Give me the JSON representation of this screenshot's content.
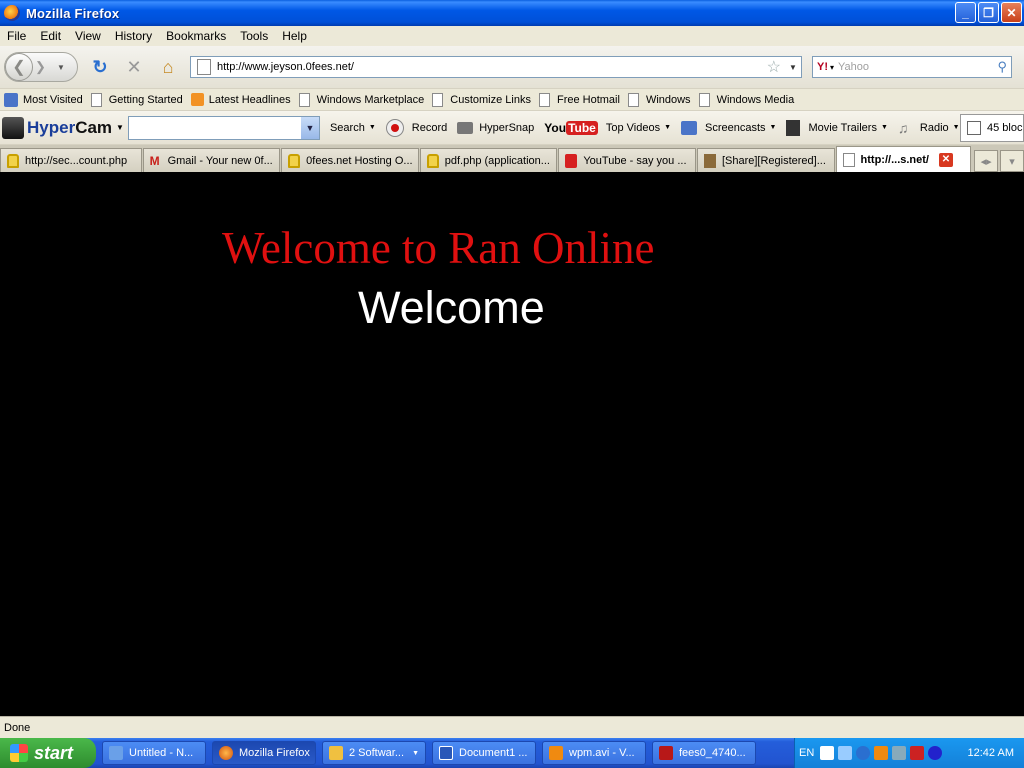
{
  "window": {
    "title": "Mozilla Firefox"
  },
  "menu": [
    {
      "label": "File"
    },
    {
      "label": "Edit"
    },
    {
      "label": "View"
    },
    {
      "label": "History"
    },
    {
      "label": "Bookmarks"
    },
    {
      "label": "Tools"
    },
    {
      "label": "Help"
    }
  ],
  "nav": {
    "url": "http://www.jeyson.0fees.net/",
    "search_placeholder": "Yahoo",
    "search_engine_logo": "Y!"
  },
  "bookmarks": [
    {
      "label": "Most Visited",
      "icon": "most-visited-icon"
    },
    {
      "label": "Getting Started",
      "icon": "page-icon"
    },
    {
      "label": "Latest Headlines",
      "icon": "rss-icon"
    },
    {
      "label": "Windows Marketplace",
      "icon": "page-icon"
    },
    {
      "label": "Customize Links",
      "icon": "page-icon"
    },
    {
      "label": "Free Hotmail",
      "icon": "page-icon"
    },
    {
      "label": "Windows",
      "icon": "page-icon"
    },
    {
      "label": "Windows Media",
      "icon": "page-icon"
    }
  ],
  "hypercam": {
    "logo_hyper": "Hyper",
    "logo_cam": "Cam",
    "search": "Search",
    "record": "Record",
    "hypersnap": "HyperSnap",
    "youtube_logo_you": "You",
    "youtube_logo_tube": "Tube",
    "top_videos": "Top Videos",
    "screencasts": "Screencasts",
    "movie_trailers": "Movie Trailers",
    "radio": "Radio",
    "blocked": "45 bloc"
  },
  "tabs": [
    {
      "label": "http://sec...count.php",
      "icon": "lock-icon"
    },
    {
      "label": "Gmail - Your new 0f...",
      "icon": "gmail-icon"
    },
    {
      "label": "0fees.net Hosting O...",
      "icon": "lock-icon"
    },
    {
      "label": "pdf.php (application...",
      "icon": "lock-icon"
    },
    {
      "label": "YouTube - say you ...",
      "icon": "youtube-icon"
    },
    {
      "label": "[Share][Registered]...",
      "icon": "share-icon"
    },
    {
      "label": "http://...s.net/",
      "icon": "page-icon",
      "active": true
    }
  ],
  "content": {
    "title": "Welcome to Ran Online",
    "subtitle": "Welcome",
    "title_color": "#e01010",
    "subtitle_color": "#ffffff",
    "background": "#000000"
  },
  "status": {
    "text": "Done"
  },
  "taskbar": {
    "start_label": "start",
    "tasks": [
      {
        "label": "Untitled - N...",
        "icon": "notepad-icon"
      },
      {
        "label": "Mozilla Firefox",
        "icon": "firefox-icon",
        "active": true
      },
      {
        "label": "2 Softwar...",
        "icon": "software-icon"
      },
      {
        "label": "Document1 ...",
        "icon": "word-icon"
      },
      {
        "label": "wpm.avi - V...",
        "icon": "vlc-icon"
      },
      {
        "label": "fees0_4740...",
        "icon": "filezilla-icon"
      }
    ],
    "lang": "EN",
    "clock": "12:42 AM"
  }
}
